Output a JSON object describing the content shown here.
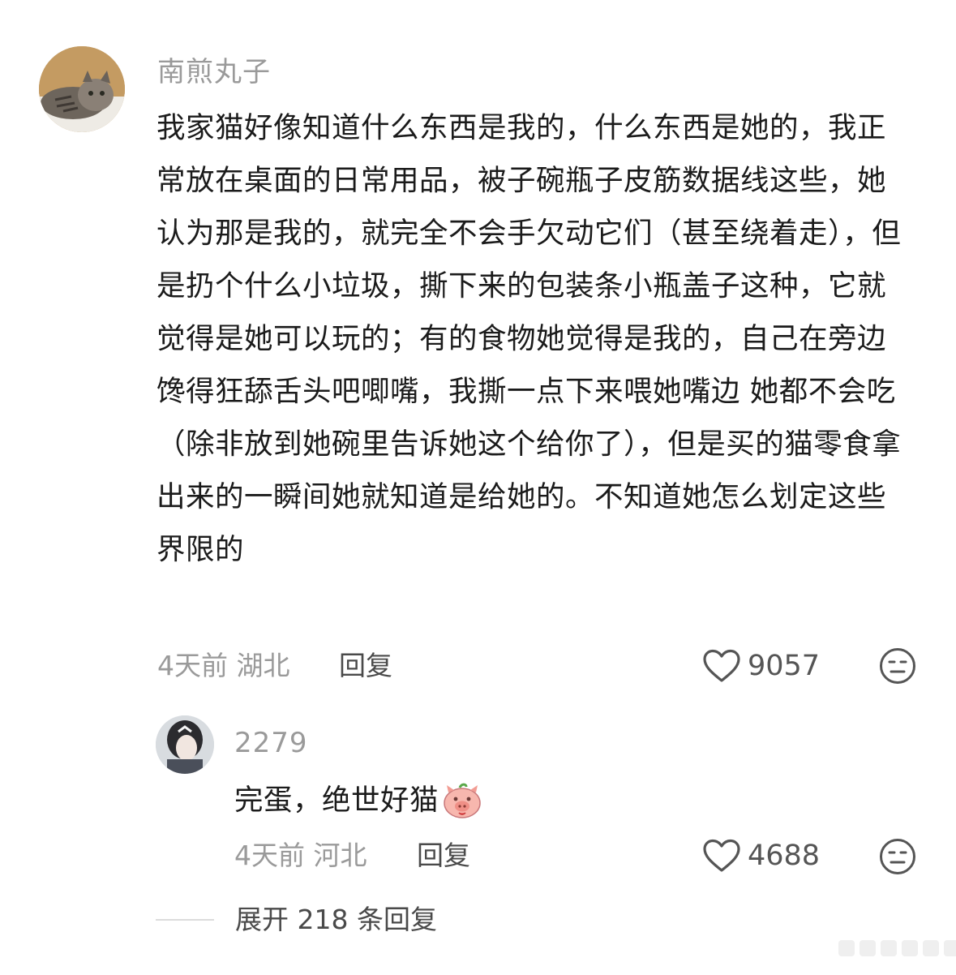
{
  "comment": {
    "username": "南煎丸子",
    "text": "我家猫好像知道什么东西是我的，什么东西是她的，我正常放在桌面的日常用品，被子碗瓶子皮筋数据线这些，她认为那是我的，就完全不会手欠动它们（甚至绕着走），但是扔个什么小垃圾，撕下来的包装条小瓶盖子这种，它就觉得是她可以玩的；有的食物她觉得是我的，自己在旁边馋得狂舔舌头吧唧嘴，我撕一点下来喂她嘴边 她都不会吃（除非放到她碗里告诉她这个给你了），但是买的猫零食拿出来的一瞬间她就知道是给她的。不知道她怎么划定这些界限的",
    "time_location": "4天前 湖北",
    "reply_label": "回复",
    "likes": "9057"
  },
  "reply": {
    "username": "2279",
    "text": "完蛋，绝世好猫",
    "emoji_icon": "pig-face-emoji",
    "time_location": "4天前 河北",
    "reply_label": "回复",
    "likes": "4688"
  },
  "expand": {
    "label": "展开 218 条回复"
  }
}
